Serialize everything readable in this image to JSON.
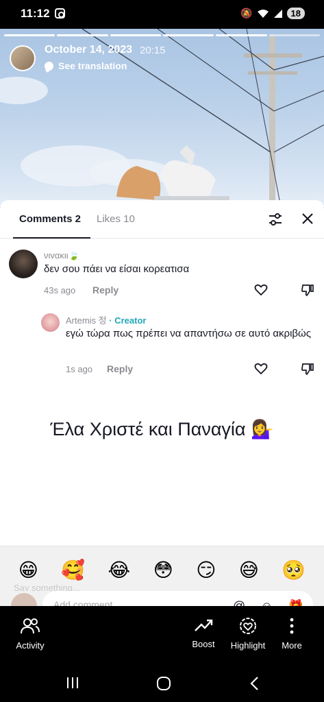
{
  "status_bar": {
    "time": "11:12",
    "battery": "18"
  },
  "video": {
    "date": "October 14, 2023",
    "time": "20:15",
    "translate": "See translation"
  },
  "sheet": {
    "tabs": {
      "comments": "Comments 2",
      "likes": "Likes 10"
    }
  },
  "comments": [
    {
      "username": "νιvακιι🍃",
      "text": "δεν σου πάει να είσαι κορεατισα",
      "age": "43s ago",
      "reply": "Reply"
    },
    {
      "username": "Artemis 정",
      "badge": "· Creator",
      "text": "εγώ τώρα πως πρέπει να απαντήσω σε αυτό ακριβώς",
      "age": "1s ago",
      "reply": "Reply"
    }
  ],
  "caption": "Έλα Χριστέ και Παναγία 💁‍♀️",
  "emojis": [
    "😁",
    "🥰",
    "😂",
    "😳",
    "😏",
    "😅",
    "🥺"
  ],
  "say_something": "Say something...",
  "comment_placeholder": "Add comment...",
  "actions": {
    "activity": "Activity",
    "boost": "Boost",
    "highlight": "Highlight",
    "more": "More"
  }
}
